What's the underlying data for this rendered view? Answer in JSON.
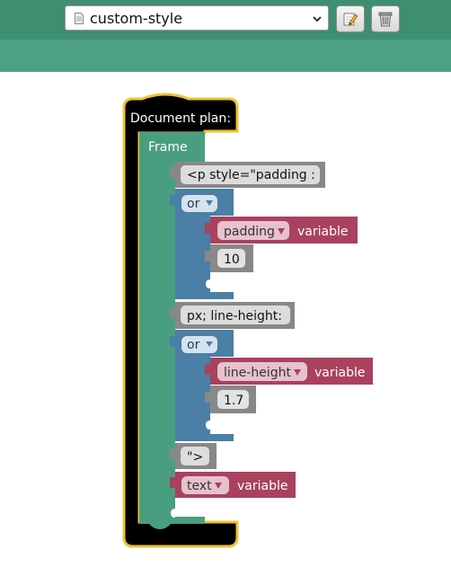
{
  "toolbar": {
    "file_name": "custom-style",
    "file_icon": "document-icon",
    "edit_icon": "pencil-edit-icon",
    "delete_icon": "trash-icon"
  },
  "blocks": {
    "document_plan": "Document plan:",
    "frame": "Frame",
    "string_1": "<p style=\"padding :",
    "or_1": "or",
    "padding_var": "padding",
    "padding_suffix": "variable",
    "padding_default": "10",
    "string_2": "px; line-height:",
    "or_2": "or",
    "line_height_var": "line-height",
    "line_height_suffix": "variable",
    "line_height_default": "1.7",
    "string_3": "\">",
    "text_var": "text",
    "text_suffix": "variable"
  },
  "colors": {
    "toolbar": "#3e8e70",
    "subbar": "#4ca083",
    "frame": "#4a9e80",
    "string_block": "#888888",
    "or_block": "#4b7fa6",
    "variable_block": "#a9415f",
    "document_plan": "#000000",
    "document_outline": "#f0c231"
  }
}
